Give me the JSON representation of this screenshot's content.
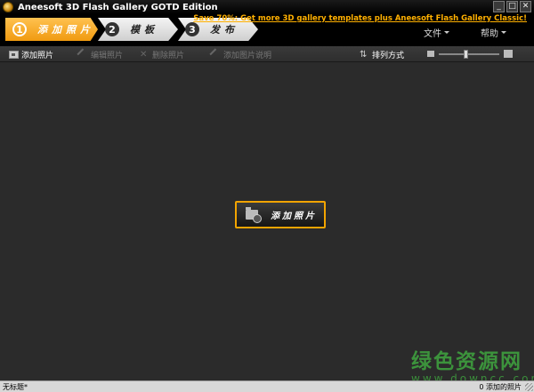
{
  "window": {
    "title": "Aneesoft 3D Flash Gallery GOTD Edition",
    "controls": [
      "_",
      "□",
      "✕"
    ]
  },
  "steps": [
    {
      "number": "1",
      "label": "添加照片",
      "active": true
    },
    {
      "number": "2",
      "label": "模板",
      "active": false
    },
    {
      "number": "3",
      "label": "发布",
      "active": false
    }
  ],
  "promo": {
    "text": "Save 70%: Get more 3D gallery templates plus Aneesoft Flash Gallery Classic!"
  },
  "menu": {
    "file": "文件",
    "help": "帮助"
  },
  "toolbar": {
    "add_photo": "添加照片",
    "edit_photo": "编辑照片",
    "delete_photo": "删除照片",
    "add_description": "添加图片说明",
    "sort": "排列方式",
    "zoom_level": 0.45
  },
  "canvas": {
    "add_photo_button": "添加照片"
  },
  "watermark": {
    "cn": "绿色资源网",
    "en": "www.downcc.com"
  },
  "status": {
    "left": "无标题*",
    "right": "0 添加的照片"
  },
  "colors": {
    "accent": "#f2a400",
    "background": "#2b2b2b",
    "watermark": "#3fa63f"
  }
}
